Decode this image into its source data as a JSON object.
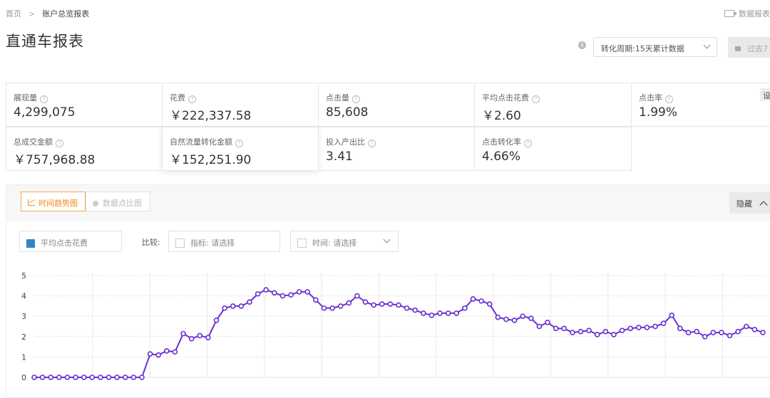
{
  "breadcrumb": {
    "home": "首页",
    "separator": ">",
    "current": "账户总览报表"
  },
  "header": {
    "data_report": "数据报表",
    "title": "直通车报表"
  },
  "toolbar": {
    "period_select": "转化周期:15天累计数据",
    "date_range": "过去7"
  },
  "metrics": [
    {
      "label": "展现量",
      "value": "4,299,075"
    },
    {
      "label": "花费",
      "value": "￥222,337.58"
    },
    {
      "label": "点击量",
      "value": "85,608"
    },
    {
      "label": "平均点击花费",
      "value": "￥2.60"
    },
    {
      "label": "点击率",
      "value": "1.99%"
    },
    {
      "label": "总成交金额",
      "value": "￥757,968.88"
    },
    {
      "label": "自然流量转化金额",
      "value": "￥152,251.90"
    },
    {
      "label": "投入产出比",
      "value": "3.41"
    },
    {
      "label": "点击转化率",
      "value": "4.66%"
    }
  ],
  "settings_label": "设",
  "chart_panel": {
    "tab_trend": "时间趋势图",
    "tab_scatter": "数据点比图",
    "hide_label": "隐藏",
    "metric_filter": "平均点击花费",
    "compare_label": "比较:",
    "indicator_filter": "指标:  请选择",
    "time_filter": "时间:  请选择"
  },
  "chart_data": {
    "type": "line",
    "series": [
      {
        "name": "平均点击花费",
        "color": "#6a2fd1",
        "values": [
          0,
          0,
          0,
          0,
          0,
          0,
          0,
          0,
          0,
          0,
          0,
          0,
          0,
          0,
          1.15,
          1.1,
          1.3,
          1.25,
          2.15,
          1.9,
          2.05,
          1.95,
          2.8,
          3.4,
          3.5,
          3.5,
          3.7,
          4.1,
          4.3,
          4.15,
          4.0,
          4.05,
          4.2,
          4.2,
          3.8,
          3.4,
          3.4,
          3.5,
          3.65,
          4.0,
          3.7,
          3.55,
          3.6,
          3.6,
          3.55,
          3.4,
          3.3,
          3.15,
          3.05,
          3.15,
          3.15,
          3.15,
          3.4,
          3.85,
          3.75,
          3.6,
          2.95,
          2.85,
          2.8,
          3.0,
          2.9,
          2.5,
          2.7,
          2.4,
          2.4,
          2.2,
          2.25,
          2.3,
          2.1,
          2.25,
          2.1,
          2.3,
          2.4,
          2.45,
          2.45,
          2.5,
          2.65,
          3.05,
          2.4,
          2.2,
          2.25,
          2.0,
          2.2,
          2.2,
          2.05,
          2.25,
          2.5,
          2.35,
          2.2
        ]
      }
    ],
    "yticks": [
      0,
      1,
      2,
      3,
      4,
      5
    ],
    "ylim": [
      0,
      5
    ],
    "grid": true,
    "colors": {
      "line": "#6a2fd1",
      "grid": "#e4e4e4"
    }
  }
}
